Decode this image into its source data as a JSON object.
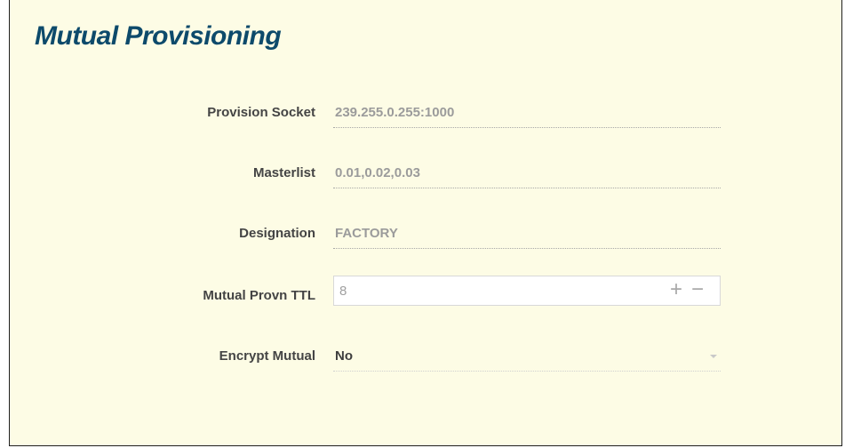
{
  "panel": {
    "title": "Mutual Provisioning"
  },
  "form": {
    "provision_socket": {
      "label": "Provision Socket",
      "value": "239.255.0.255:1000"
    },
    "masterlist": {
      "label": "Masterlist",
      "value": "0.01,0.02,0.03"
    },
    "designation": {
      "label": "Designation",
      "value": "FACTORY"
    },
    "mutual_provn_ttl": {
      "label": "Mutual Provn TTL",
      "value": "8",
      "plus": "+",
      "minus": "−"
    },
    "encrypt_mutual": {
      "label": "Encrypt Mutual",
      "value": "No"
    }
  },
  "colors": {
    "title": "#0d4a6b",
    "panel_background": "#fdfce5",
    "label": "#444444",
    "value": "#9b9b9b"
  },
  "icons": {
    "plus": "plus-icon",
    "minus": "minus-icon",
    "dropdown": "chevron-down-icon"
  }
}
